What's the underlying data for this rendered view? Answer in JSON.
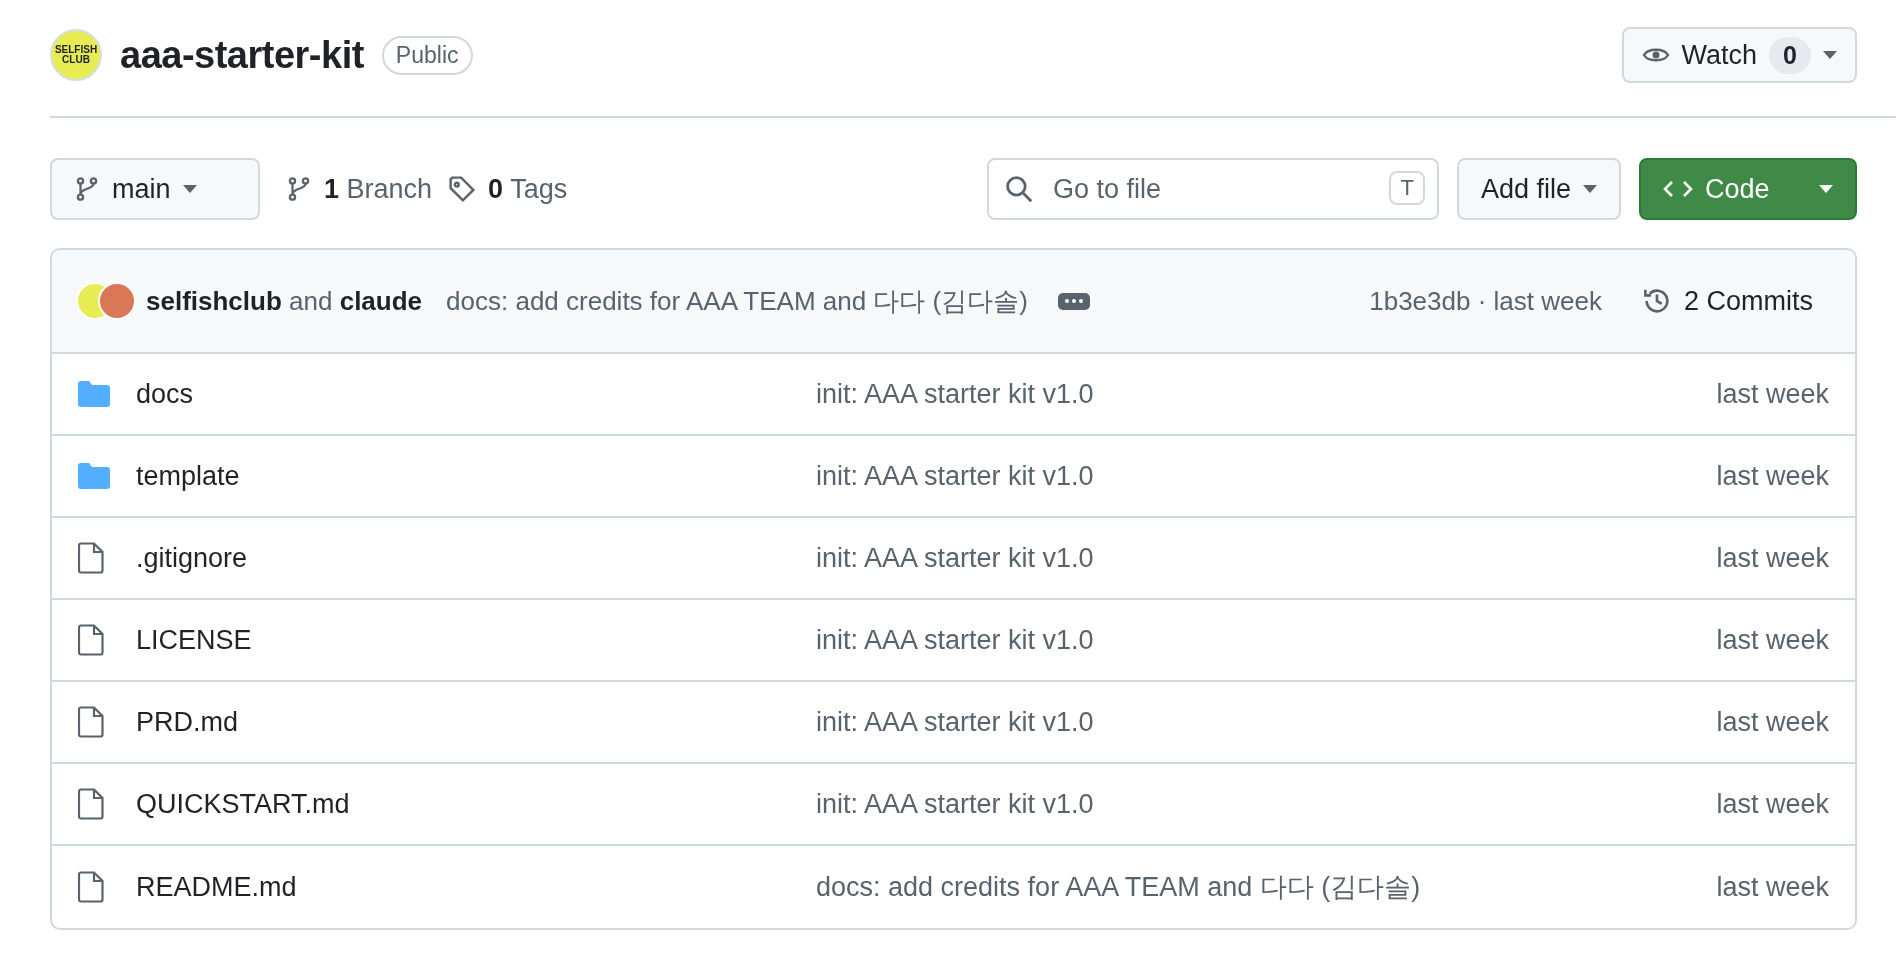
{
  "repo": {
    "avatar_text": [
      "SELFISH",
      "CLUB"
    ],
    "name": "aaa-starter-kit",
    "visibility": "Public"
  },
  "watch": {
    "label": "Watch",
    "count": "0"
  },
  "toolbar": {
    "branch": "main",
    "branches": {
      "count": "1",
      "label": "Branch"
    },
    "tags": {
      "count": "0",
      "label": "Tags"
    },
    "search": {
      "placeholder": "Go to file",
      "shortcut": "T"
    },
    "add_file": "Add file",
    "code": "Code"
  },
  "latest_commit": {
    "author": "selfishclub",
    "joiner": "and",
    "coauthor": "claude",
    "message": "docs: add credits for AAA TEAM and 다다 (김다솔)",
    "sha": "1b3e3db",
    "separator": "·",
    "time": "last week",
    "commits": "2 Commits"
  },
  "files": [
    {
      "kind": "folder",
      "name": "docs",
      "message": "init: AAA starter kit v1.0",
      "time": "last week"
    },
    {
      "kind": "folder",
      "name": "template",
      "message": "init: AAA starter kit v1.0",
      "time": "last week"
    },
    {
      "kind": "file",
      "name": ".gitignore",
      "message": "init: AAA starter kit v1.0",
      "time": "last week"
    },
    {
      "kind": "file",
      "name": "LICENSE",
      "message": "init: AAA starter kit v1.0",
      "time": "last week"
    },
    {
      "kind": "file",
      "name": "PRD.md",
      "message": "init: AAA starter kit v1.0",
      "time": "last week"
    },
    {
      "kind": "file",
      "name": "QUICKSTART.md",
      "message": "init: AAA starter kit v1.0",
      "time": "last week"
    },
    {
      "kind": "file",
      "name": "README.md",
      "message": "docs: add credits for AAA TEAM and 다다 (김다솔)",
      "time": "last week"
    }
  ]
}
